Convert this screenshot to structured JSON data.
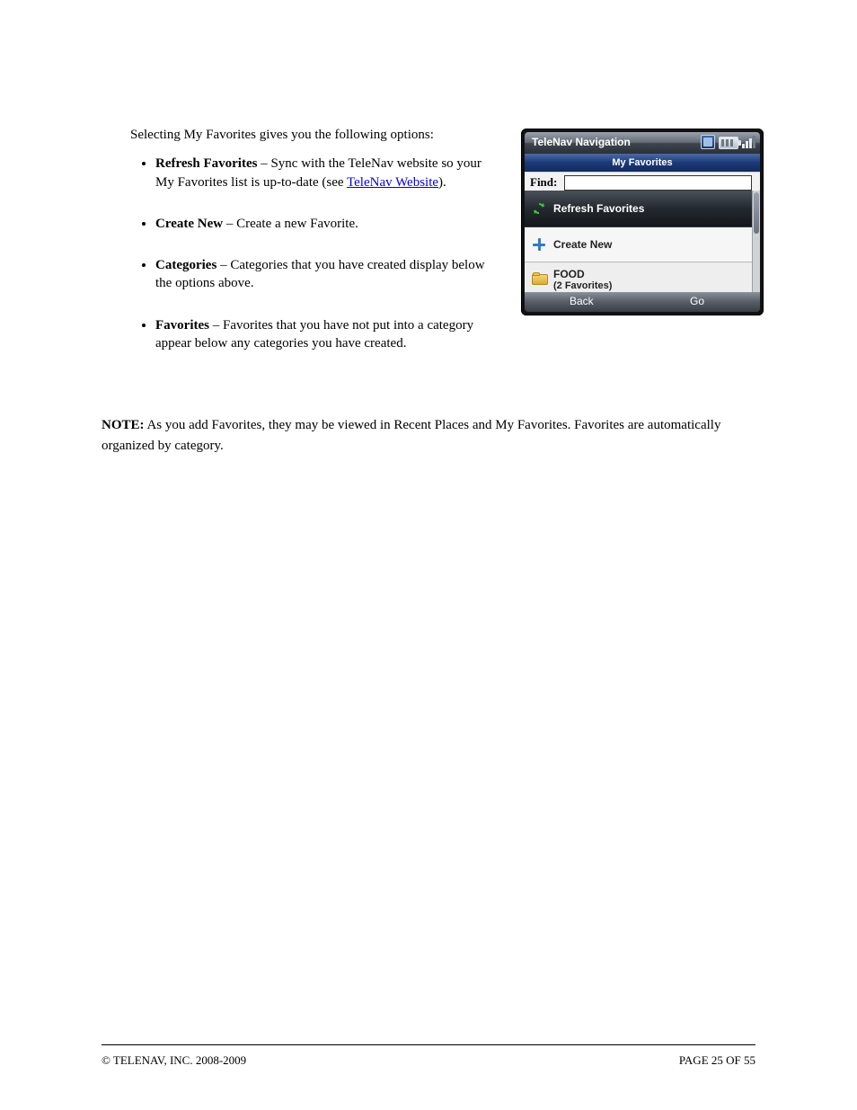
{
  "intro": "Selecting My Favorites gives you the following options:",
  "bullets": [
    {
      "bold": "Refresh Favorites",
      "text": " – Sync with the TeleNav website so your My Favorites list is up-to-date (see ",
      "link_text": "TeleNav Website",
      "tail": ")."
    },
    {
      "bold": "Create New",
      "text": " – Create a new Favorite."
    },
    {
      "bold": "Categories",
      "text": " – Categories that you have created display below the options above."
    },
    {
      "bold": "Favorites",
      "text": " – Favorites that you have not put into a category appear below any categories you have created."
    }
  ],
  "note_bold": "NOTE:",
  "note_text": " As you add Favorites, they may be viewed in Recent Places and My Favorites. Favorites are automatically organized by category.",
  "footer_left": "© TELENAV, INC. 2008-2009",
  "footer_right": "PAGE 25 OF 55",
  "shot": {
    "title": "TeleNav Navigation",
    "header": "My Favorites",
    "find_label": "Find:",
    "rows": {
      "refresh": "Refresh Favorites",
      "create": "Create New",
      "folder_name": "FOOD",
      "folder_sub": "(2 Favorites)"
    },
    "softkeys": {
      "left": "Back",
      "right": "Go"
    }
  }
}
